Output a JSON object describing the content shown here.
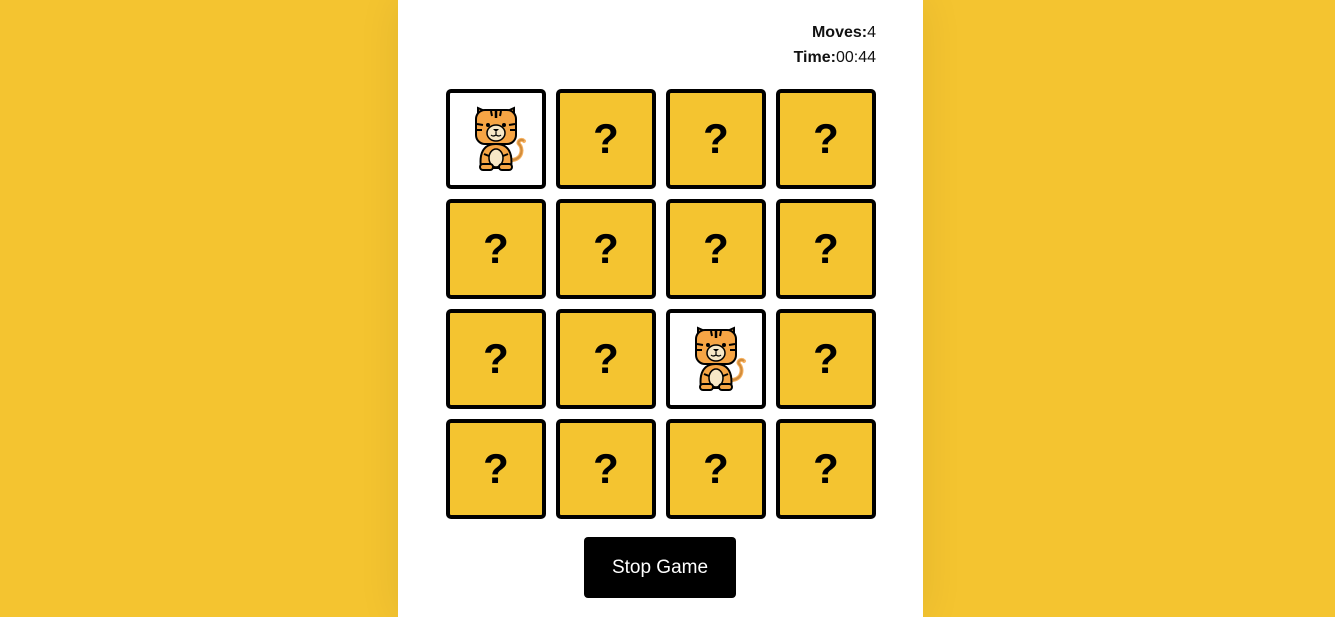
{
  "stats": {
    "moves_label": "Moves:",
    "moves_value": "4",
    "time_label": "Time:",
    "time_value": "00:44"
  },
  "cards": [
    {
      "state": "flipped",
      "icon": "tiger-icon",
      "face": "?"
    },
    {
      "state": "hidden",
      "face": "?"
    },
    {
      "state": "hidden",
      "face": "?"
    },
    {
      "state": "hidden",
      "face": "?"
    },
    {
      "state": "hidden",
      "face": "?"
    },
    {
      "state": "hidden",
      "face": "?"
    },
    {
      "state": "hidden",
      "face": "?"
    },
    {
      "state": "hidden",
      "face": "?"
    },
    {
      "state": "hidden",
      "face": "?"
    },
    {
      "state": "hidden",
      "face": "?"
    },
    {
      "state": "flipped",
      "icon": "tiger-icon",
      "face": "?"
    },
    {
      "state": "hidden",
      "face": "?"
    },
    {
      "state": "hidden",
      "face": "?"
    },
    {
      "state": "hidden",
      "face": "?"
    },
    {
      "state": "hidden",
      "face": "?"
    },
    {
      "state": "hidden",
      "face": "?"
    }
  ],
  "stop_button_label": "Stop Game",
  "colors": {
    "background": "#f4c430",
    "card_back": "#f4c430",
    "card_front": "#ffffff",
    "button": "#000000"
  }
}
